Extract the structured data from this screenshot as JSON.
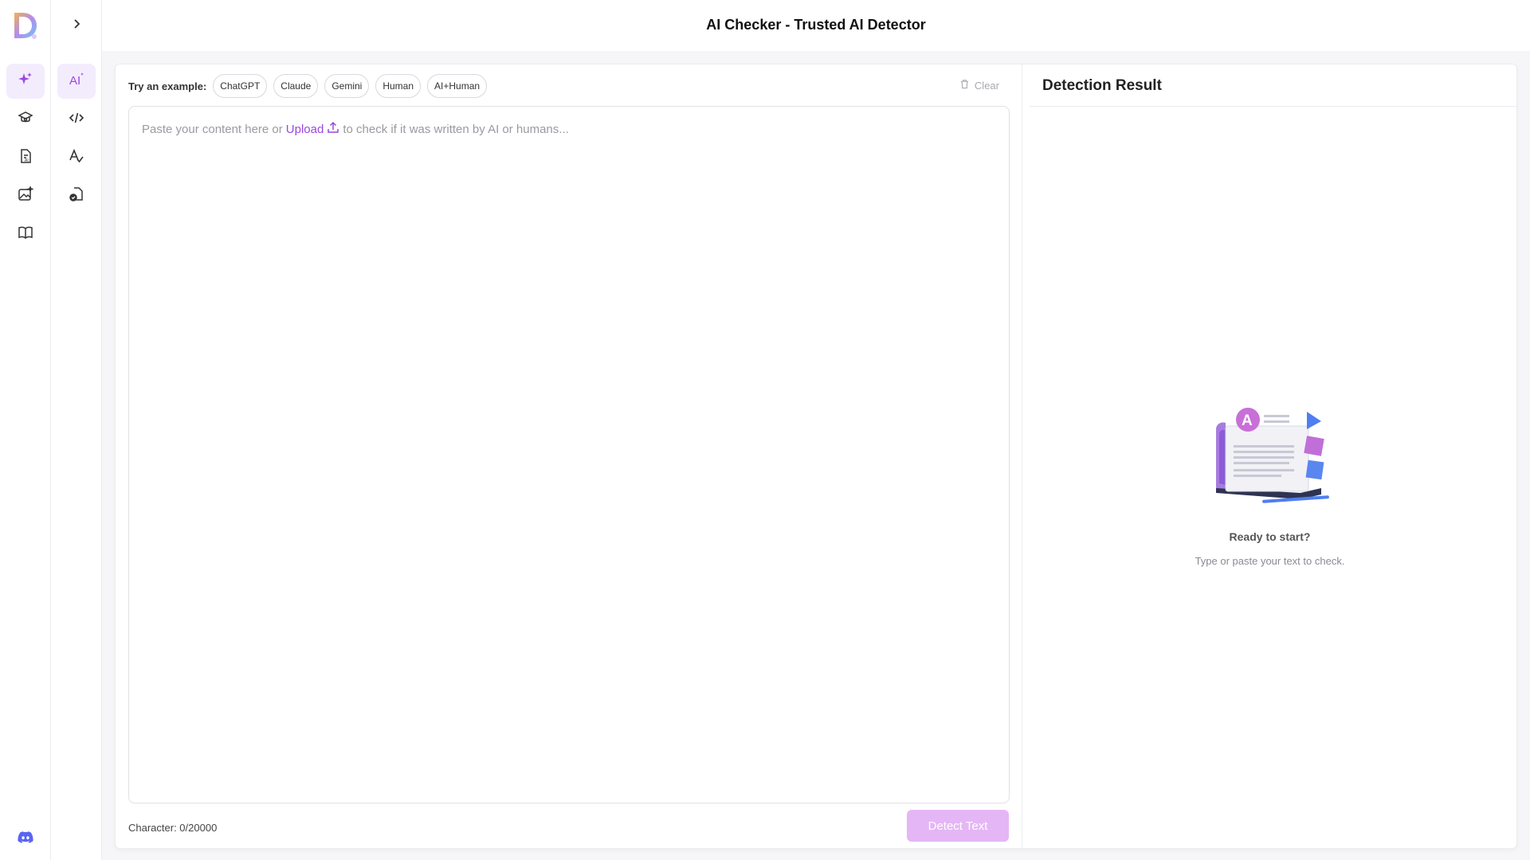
{
  "header": {
    "title": "AI Checker - Trusted AI Detector"
  },
  "rail": {
    "items": [
      {
        "icon": "sparkles-icon",
        "active": true
      },
      {
        "icon": "graduation-cap-icon",
        "active": false
      },
      {
        "icon": "ai-document-icon",
        "active": false
      },
      {
        "icon": "ai-image-icon",
        "active": false
      },
      {
        "icon": "book-icon",
        "active": false
      }
    ],
    "bottom_icon": "discord-icon"
  },
  "subnav": {
    "items": [
      {
        "icon": "ai-text-icon",
        "active": true
      },
      {
        "icon": "code-icon",
        "active": false
      },
      {
        "icon": "grammar-icon",
        "active": false
      },
      {
        "icon": "file-check-icon",
        "active": false
      }
    ]
  },
  "editor": {
    "examples_label": "Try an example:",
    "examples": [
      "ChatGPT",
      "Claude",
      "Gemini",
      "Human",
      "AI+Human"
    ],
    "clear_label": "Clear",
    "placeholder_before": "Paste your content here or",
    "upload_label": "Upload",
    "placeholder_after": "to check if it was written by AI or humans...",
    "char_count": "Character: 0/20000",
    "detect_label": "Detect Text"
  },
  "result": {
    "title": "Detection Result",
    "ready_title": "Ready to start?",
    "ready_subtitle": "Type or paste your text to check."
  },
  "colors": {
    "accent": "#9b46e0",
    "accent_light": "#e5b6f6",
    "active_bg": "#f3ecfd",
    "discord": "#5865f2"
  }
}
